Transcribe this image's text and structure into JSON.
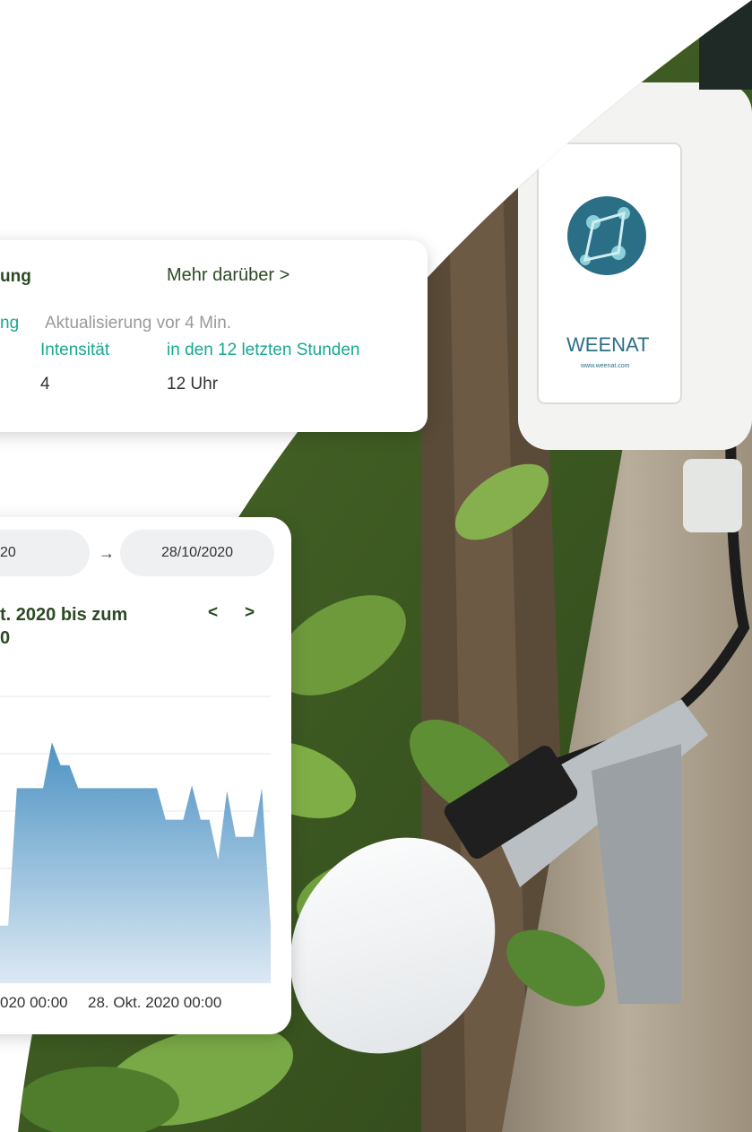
{
  "info_card": {
    "title_fragment": "ung",
    "more_link": "Mehr darüber >",
    "row1_fragment": "ng",
    "update_text": "Aktualisierung vor 4 Min.",
    "col_intensity_header": "Intensität",
    "col_period_header": "in den 12 letzten Stunden",
    "intensity_value": "4",
    "period_value": "12 Uhr"
  },
  "chart_card": {
    "date_from_fragment": "20",
    "date_arrow": "→",
    "date_to": "28/10/2020",
    "title_line1": "t. 2020 bis zum",
    "title_line2": "0",
    "prev_label": "<",
    "next_label": ">",
    "x_labels": [
      "020 00:00",
      "28. Okt. 2020 00:00"
    ]
  },
  "device": {
    "brand": "WEENAT",
    "url": "www.weenat.com"
  },
  "colors": {
    "accent": "#17a891",
    "title": "#2c4a24",
    "area_top": "#4e93c3",
    "area_bottom": "#dce9f4"
  },
  "chart_data": {
    "type": "area",
    "title": "",
    "xlabel": "",
    "ylabel": "",
    "x_tick_labels": [
      "020 00:00",
      "28. Okt. 2020 00:00"
    ],
    "grid": true,
    "series": [
      {
        "values": [
          2,
          2,
          2,
          2,
          2,
          6.8,
          6.8,
          6.8,
          6.8,
          8.4,
          7.6,
          7.6,
          6.8,
          6.8,
          6.8,
          6.8,
          6.8,
          6.8,
          6.8,
          6.8,
          6.8,
          6.8,
          5.7,
          5.7,
          5.7,
          6.9,
          5.7,
          5.7,
          4.3,
          6.7,
          5.1,
          5.1,
          5.1,
          6.8,
          2.0
        ]
      }
    ]
  }
}
